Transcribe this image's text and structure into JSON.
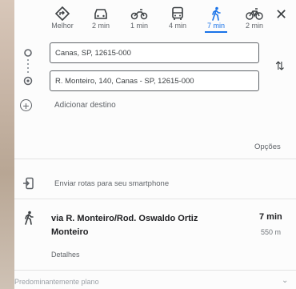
{
  "modes": [
    {
      "id": "best",
      "label": "Melhor",
      "icon": "diamond-directions-icon",
      "active": false
    },
    {
      "id": "car",
      "label": "2 min",
      "icon": "car-icon",
      "active": false
    },
    {
      "id": "moto",
      "label": "1 min",
      "icon": "motorcycle-icon",
      "active": false
    },
    {
      "id": "transit",
      "label": "4 min",
      "icon": "bus-icon",
      "active": false
    },
    {
      "id": "walk",
      "label": "7 min",
      "icon": "walk-icon",
      "active": true
    },
    {
      "id": "bike",
      "label": "2 min",
      "icon": "bicycle-icon",
      "active": false
    }
  ],
  "origin": {
    "value": "Canas, SP, 12615-000"
  },
  "destination": {
    "value": "R. Monteiro, 140, Canas - SP, 12615-000"
  },
  "add_destination": "Adicionar destino",
  "options_label": "Opções",
  "send_label": "Enviar rotas para seu smartphone",
  "route": {
    "title": "via R. Monteiro/Rod. Oswaldo Ortiz Monteiro",
    "time": "7 min",
    "distance": "550 m",
    "details": "Detalhes"
  },
  "footer": "Predominantemente plano",
  "colors": {
    "accent": "#1a73e8"
  }
}
